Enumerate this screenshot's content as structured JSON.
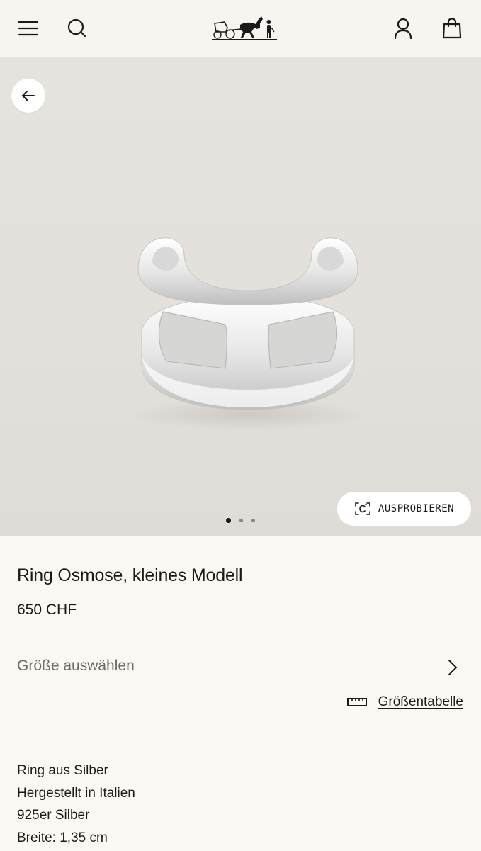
{
  "header": {
    "menu_icon": "hamburger-menu-icon",
    "search_icon": "search-icon",
    "logo": "hermes-carriage-logo",
    "account_icon": "user-icon",
    "bag_icon": "shopping-bag-icon"
  },
  "gallery": {
    "back_icon": "arrow-left-icon",
    "try_on_label": "AUSPROBIEREN",
    "try_on_icon": "camera-scan-icon",
    "image_count": 3,
    "active_index": 0
  },
  "product": {
    "title": "Ring Osmose, kleines Modell",
    "price": "650 CHF",
    "size_select_label": "Größe auswählen",
    "size_table_label": "Größentabelle",
    "details": [
      "Ring aus Silber",
      "Hergestellt in Italien",
      "925er Silber",
      "Breite: 1,35 cm"
    ]
  },
  "colors": {
    "background": "#fcf9f4",
    "header_background": "#f8f5f0",
    "image_background": "#e4e1dd",
    "text": "#1a1a1a",
    "muted_text": "#6c6862"
  }
}
